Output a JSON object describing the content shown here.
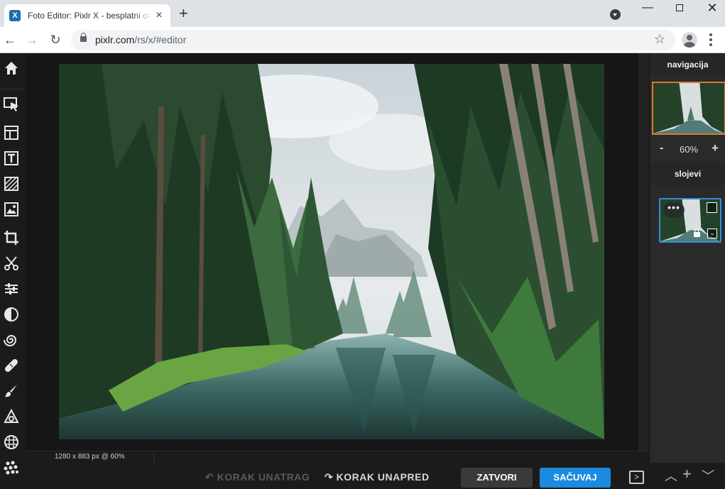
{
  "browser": {
    "tab_title": "Foto Editor: Pixlr X - besplatni on",
    "tab_favicon": "X",
    "url_host": "pixlr.com",
    "url_path": "/rs/x/#editor",
    "new_tab": "+",
    "close_tab": "×"
  },
  "toolbar": {
    "tools": [
      "home-icon",
      "arrange-icon",
      "layout-icon",
      "text-icon",
      "pattern-icon",
      "image-icon",
      "crop-icon",
      "cutout-icon",
      "adjust-icon",
      "filter-icon",
      "liquify-icon",
      "retouch-icon",
      "draw-icon",
      "elements-icon",
      "texture-icon",
      "effect-icon"
    ]
  },
  "canvas": {
    "status": "1280 x 883 px @ 60%"
  },
  "right_panel": {
    "navigation_title": "navigacija",
    "zoom_minus": "-",
    "zoom_value": "60%",
    "zoom_plus": "+",
    "layers_title": "slojevi",
    "layer_menu": "•••"
  },
  "bottom_bar": {
    "undo": "KORAK UNATRAG",
    "redo": "KORAK UNAPRED",
    "close": "ZATVORI",
    "save": "SAČUVAJ",
    "panel_toggle": ">"
  },
  "colors": {
    "accent_save": "#1a8be0",
    "nav_highlight": "#e0762f",
    "layer_selected": "#2f8fd6"
  }
}
